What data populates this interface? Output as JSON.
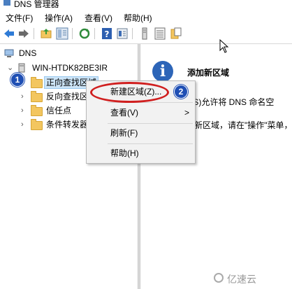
{
  "window": {
    "title": "DNS 管理器"
  },
  "menu": [
    "文件(F)",
    "操作(A)",
    "查看(V)",
    "帮助(H)"
  ],
  "toolbar": [
    "back-icon",
    "forward-icon",
    "up-folder-icon",
    "show-tree-icon",
    "refresh-icon",
    "help-icon",
    "properties-icon",
    "server-icon",
    "list-icon",
    "export-icon"
  ],
  "tree": {
    "root": "DNS",
    "server": "WIN-HTDK82BE3IR",
    "items": [
      "正向查找区域",
      "反向查找区域",
      "信任点",
      "条件转发器"
    ]
  },
  "right": {
    "heading": "添加新区域",
    "line1": "(DNS)允许将 DNS 命名空",
    "line2": "新区域，请在\"操作\"菜单，"
  },
  "context_menu": {
    "items": [
      "新建区域(Z)...",
      "查看(V)",
      "刷新(F)",
      "帮助(H)"
    ],
    "submenu_arrow": ">"
  },
  "badges": {
    "one": "1",
    "two": "2"
  },
  "watermark": "亿速云",
  "colors": {
    "accent": "#1f4fb4",
    "highlight": "#d01f1f",
    "folder": "#f3c65f"
  }
}
